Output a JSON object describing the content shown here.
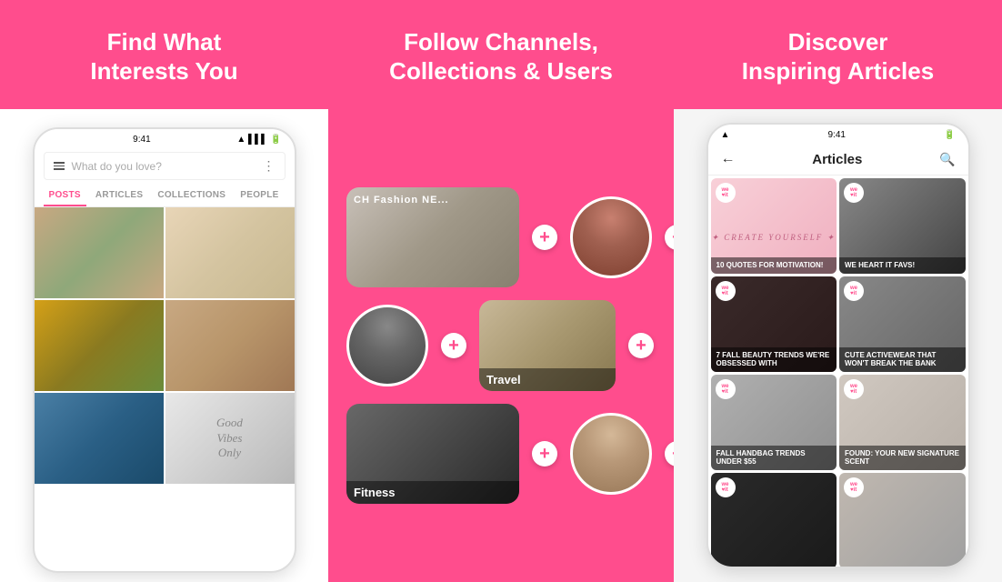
{
  "panel1": {
    "header": "Find What\nInterests You",
    "search_placeholder": "What do you love?",
    "tabs": [
      "POSTS",
      "ARTICLES",
      "COLLECTIONS",
      "PEOPLE"
    ],
    "active_tab": "POSTS",
    "status_time": "9:41"
  },
  "panel2": {
    "header": "Follow Channels,\nCollections & Users",
    "channels": [
      {
        "label": "CH... Fashion NE...",
        "type": "card",
        "style": "fashion"
      },
      {
        "type": "circle",
        "style": "girl-red"
      },
      {
        "label": "Travel",
        "type": "card",
        "style": "travel"
      },
      {
        "type": "circle",
        "style": "mountains"
      },
      {
        "label": "Fitness",
        "type": "card",
        "style": "fitness"
      },
      {
        "type": "circle",
        "style": "girl-blond"
      }
    ]
  },
  "panel3": {
    "header": "Discover\nInspiring Articles",
    "nav_title": "Articles",
    "status_time": "9:41",
    "articles": [
      {
        "id": "create",
        "style": "art-create",
        "text": "10 QUOTES FOR MOTIVATION!",
        "has_logo": true,
        "special": "create-yourself"
      },
      {
        "id": "favs",
        "style": "art-favs",
        "text": "WE HEART IT FAVS!",
        "has_logo": true
      },
      {
        "id": "beauty",
        "style": "art-beauty",
        "text": "7 FALL BEAUTY TRENDS WE'RE OBSESSED WITH",
        "has_logo": true
      },
      {
        "id": "activewear",
        "style": "art-activewear",
        "text": "CUTE ACTIVEWEAR THAT WON'T BREAK THE BANK",
        "has_logo": true
      },
      {
        "id": "handbag",
        "style": "art-handbag",
        "text": "FALL HANDBAG TRENDS UNDER $55",
        "has_logo": true
      },
      {
        "id": "scent",
        "style": "art-scent",
        "text": "FOUND: YOUR NEW SIGNATURE SCENT",
        "has_logo": true
      },
      {
        "id": "extra1",
        "style": "art-extra1",
        "text": "",
        "has_logo": true
      },
      {
        "id": "extra2",
        "style": "art-extra2",
        "text": "",
        "has_logo": true
      }
    ]
  }
}
